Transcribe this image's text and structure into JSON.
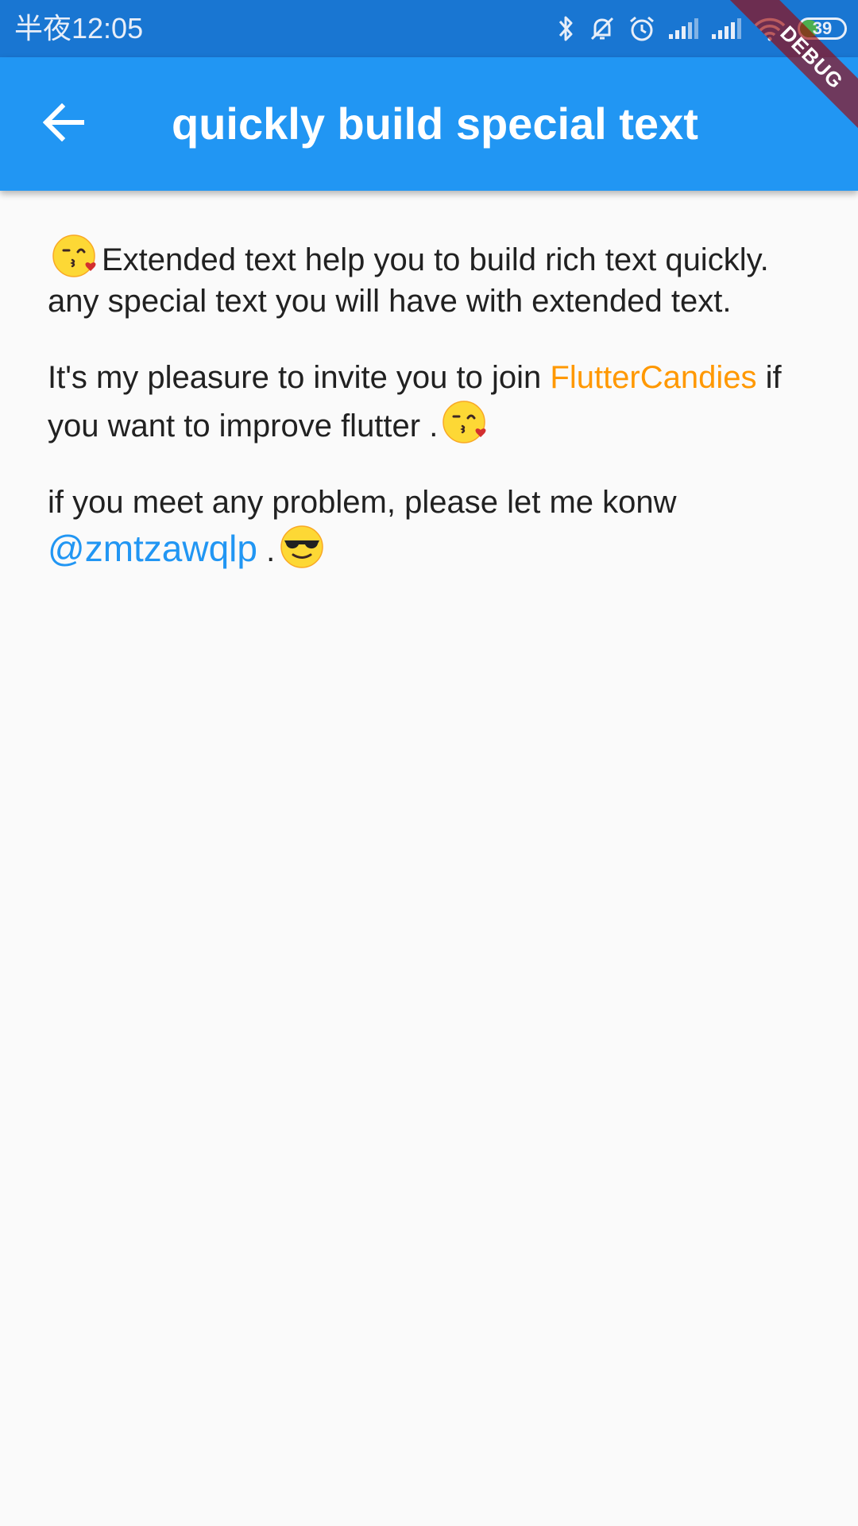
{
  "status_bar": {
    "time": "半夜12:05",
    "icons": [
      "bluetooth-icon",
      "bell-off-icon",
      "alarm-icon",
      "signal-icon",
      "signal-icon",
      "wifi-icon"
    ],
    "battery_level": "39",
    "battery_fraction": 0.39,
    "background_color": "#1976d2"
  },
  "app_bar": {
    "title": "quickly build special text",
    "back_icon": "arrow-back-icon",
    "background_color": "#2196f3"
  },
  "debug_banner": {
    "label": "DEBUG"
  },
  "content": {
    "paragraph_1": {
      "emoji": "kissing-face-emoji",
      "text_line": "Extended text help you to build rich text quickly. any special text you will have with extended text."
    },
    "paragraph_2": {
      "text_before": "It's my pleasure to invite you to join ",
      "link_text": "FlutterCandies",
      "link_color": "#ff9800",
      "text_after": " if you want to improve flutter .",
      "emoji": "kissing-face-emoji"
    },
    "paragraph_3": {
      "text_before": "if you meet any problem, please let me konw ",
      "mention_text": "@zmtzawqlp",
      "mention_color": "#2196f3",
      "text_after": " .",
      "emoji": "sunglasses-face-emoji"
    }
  }
}
